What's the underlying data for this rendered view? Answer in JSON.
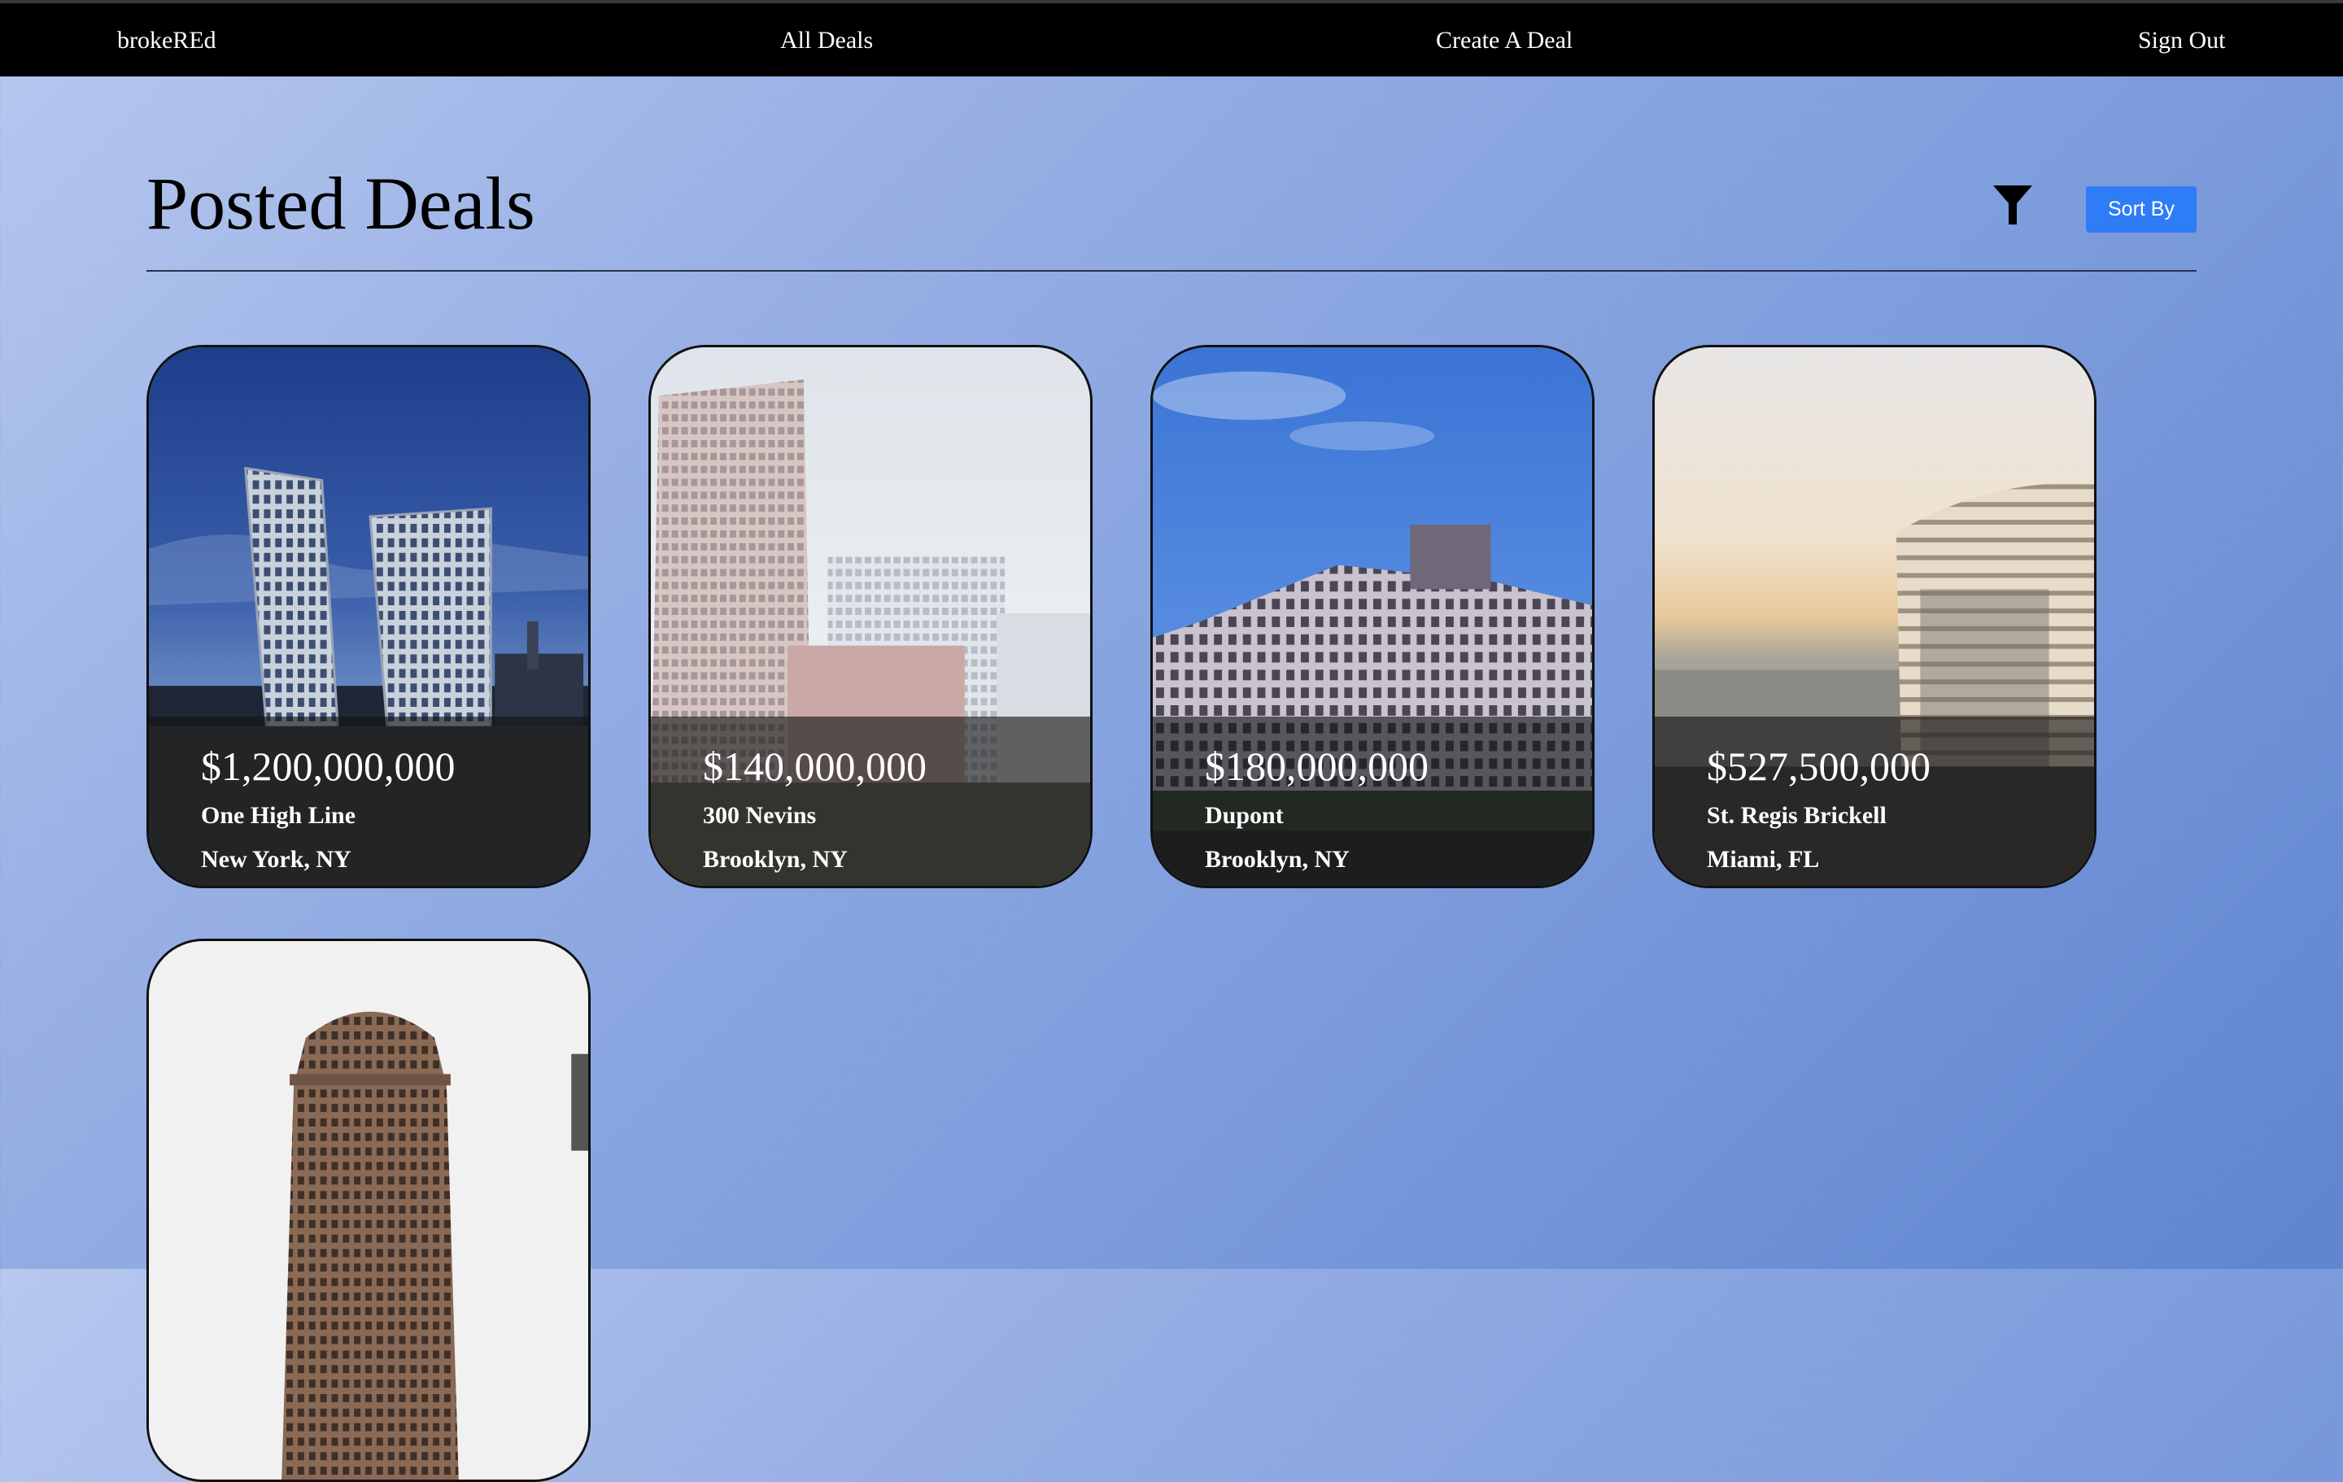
{
  "nav": {
    "brand": "brokeREd",
    "all_deals": "All Deals",
    "create_deal": "Create A Deal",
    "sign_out": "Sign Out"
  },
  "header": {
    "title": "Posted Deals",
    "filter_icon": "funnel-icon",
    "sort_label": "Sort By"
  },
  "colors": {
    "nav_background": "#000000",
    "sort_button": "#2e7cf6",
    "background_gradient": [
      "#b7c8ef",
      "#5f85d0"
    ]
  },
  "deals": [
    {
      "price": "$1,200,000,000",
      "name": "One High Line",
      "location": "New York, NY"
    },
    {
      "price": "$140,000,000",
      "name": "300 Nevins",
      "location": "Brooklyn, NY"
    },
    {
      "price": "$180,000,000",
      "name": "Dupont",
      "location": "Brooklyn, NY"
    },
    {
      "price": "$527,500,000",
      "name": "St. Regis Brickell",
      "location": "Miami, FL"
    },
    {
      "price": "",
      "name": "",
      "location": ""
    }
  ]
}
